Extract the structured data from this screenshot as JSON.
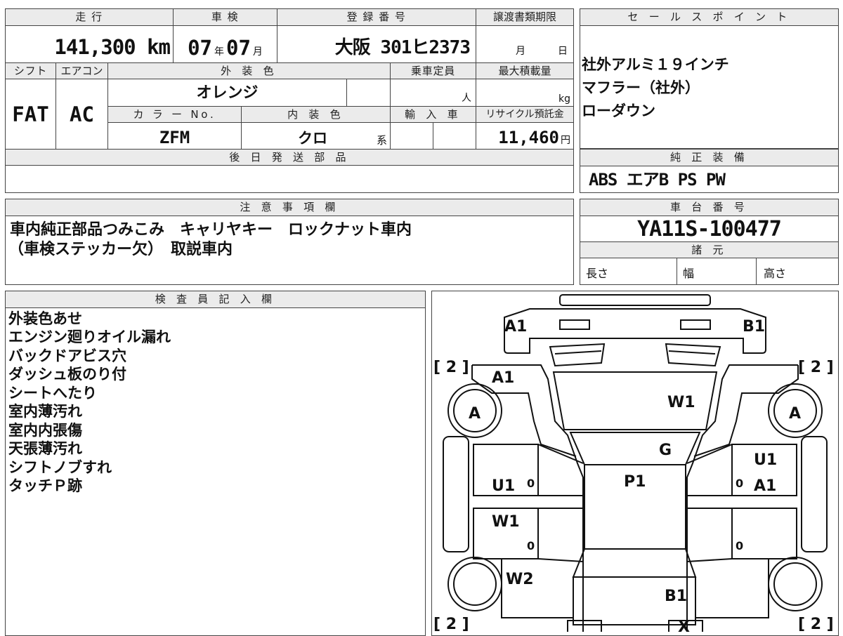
{
  "vehicle": {
    "mileage_label": "走 行",
    "mileage_value": "141,300 km",
    "inspection_label": "車 検",
    "inspection_year": "07",
    "inspection_month": "07",
    "year_suffix": "年",
    "month_suffix": "月",
    "registration_label": "登 録 番 号",
    "registration_value": "大阪 301ヒ2373",
    "transfer_deadline_label": "譲渡書類期限",
    "transfer_month_suffix": "月",
    "transfer_day_suffix": "日",
    "shift_label": "シフト",
    "shift_value": "FAT",
    "aircon_label": "エアコン",
    "aircon_value": "AC",
    "exterior_color_label": "外 装 色",
    "exterior_color_value": "オレンジ",
    "capacity_label": "乗車定員",
    "capacity_unit": "人",
    "max_load_label": "最大積載量",
    "max_load_unit": "kg",
    "color_no_label": "カ ラ ー No.",
    "color_no_value": "ZFM",
    "interior_color_label": "内 装 色",
    "interior_color_value": "クロ",
    "interior_color_suffix": "系",
    "import_label": "輸 入 車",
    "recycle_label": "リサイクル預託金",
    "recycle_value": "11,460",
    "recycle_unit": "円",
    "later_parts_label": "後 日 発 送 部 品"
  },
  "sales_points": {
    "label": "セ ー ル ス ポ イ ン ト",
    "items": [
      "社外アルミ１９インチ",
      "マフラー（社外）",
      "ローダウン"
    ]
  },
  "genuine_equipment": {
    "label": "純 正 装 備",
    "value": "ABS エアB PS PW"
  },
  "notes": {
    "label": "注 意 事 項 欄",
    "line1": "車内純正部品つみこみ　キャリヤキー　ロックナット車内",
    "line2": "（車検ステッカー欠）　取説車内"
  },
  "chassis": {
    "label": "車 台 番 号",
    "value": "YA11S-100477"
  },
  "specs": {
    "label": "諸 元",
    "length": "長さ",
    "width": "幅",
    "height": "高さ"
  },
  "inspector": {
    "label": "検 査 員 記 入 欄",
    "items": [
      "外装色あせ",
      "エンジン廻りオイル漏れ",
      "バックドアビス穴",
      "ダッシュ板のり付",
      "シートへたり",
      "室内薄汚れ",
      "室内内張傷",
      "天張薄汚れ",
      "シフトノブすれ",
      "タッチＰ跡"
    ]
  },
  "diagram_marks": {
    "front_left": "A1",
    "front_right": "B1",
    "hood_left": "A1",
    "windshield": "W1",
    "bracket_tl": "[ 2 ]",
    "bracket_tr": "[ 2 ]",
    "bracket_bl": "[ 2 ]",
    "bracket_br": "[ 2 ]",
    "wheel_fl": "A",
    "wheel_fr": "A",
    "grille": "G",
    "roof": "P1",
    "door_fl": "U1",
    "door_rl": "W1",
    "rear_left": "W2",
    "door_fr_top": "U1",
    "door_fr": "A1",
    "rear": "B1",
    "rear_mark": "X",
    "zero_1": "0",
    "zero_2": "0",
    "zero_3": "0",
    "zero_4": "0"
  }
}
